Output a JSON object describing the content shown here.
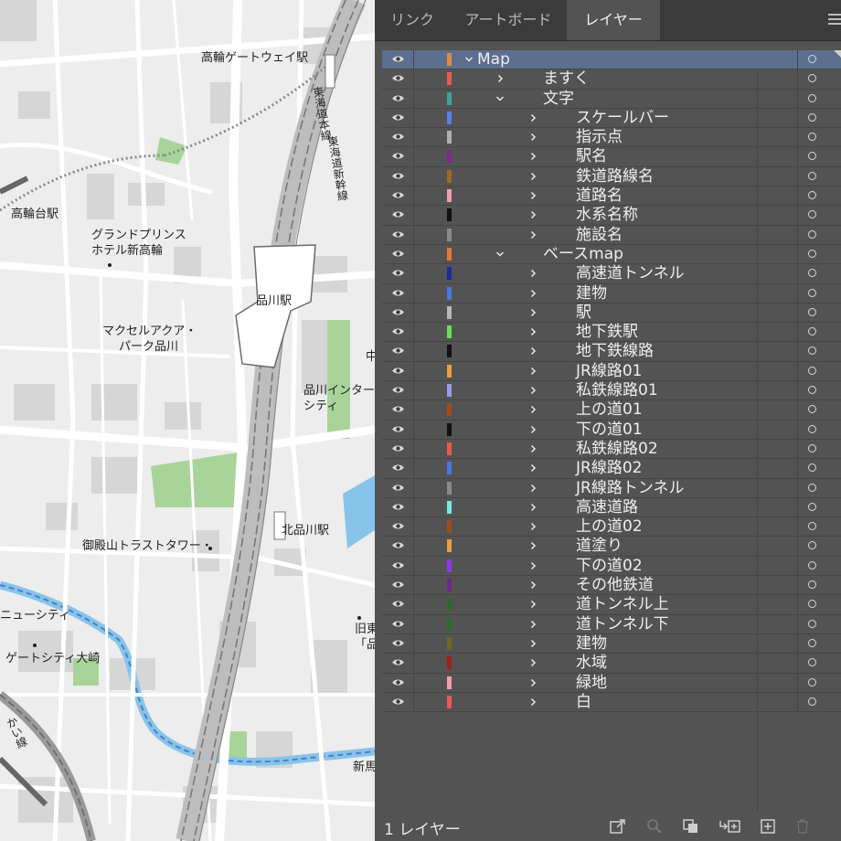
{
  "tabs": [
    {
      "label": "リンク",
      "active": false
    },
    {
      "label": "アートボード",
      "active": false
    },
    {
      "label": "レイヤー",
      "active": true
    }
  ],
  "map_labels": {
    "takanawa_gateway": "高輪ゲートウェイ駅",
    "takanawadai": "高輪台駅",
    "grand_prince_1": "グランドプリンス",
    "grand_prince_2": "ホテル新高輪",
    "shinagawa": "品川駅",
    "maxell_1": "マクセルアクア・",
    "maxell_2": "パーク品川",
    "intercity_1": "品川インター",
    "intercity_2": "シティ",
    "kitashinagawa": "北品川駅",
    "gotenyama": "御殿山トラストタワー・",
    "new_city": "ニューシティ",
    "gate_city": "ゲートシティ大崎",
    "kyu_1": "旧東",
    "kyu_2": "「品",
    "shinba": "新馬",
    "naka": "中",
    "tokaido": "東海道本線",
    "shinkansen": "東海道新幹線",
    "bottom_left_line": "かい線"
  },
  "layers": [
    {
      "name": "Map",
      "depth": 0,
      "expanded": true,
      "color": "#e08a4a",
      "selected": true
    },
    {
      "name": "ますく",
      "depth": 1,
      "expanded": false,
      "color": "#e85a5a"
    },
    {
      "name": "文字",
      "depth": 1,
      "expanded": true,
      "color": "#3aa69a"
    },
    {
      "name": "スケールバー",
      "depth": 2,
      "expanded": false,
      "color": "#5b7fe0"
    },
    {
      "name": "指示点",
      "depth": 2,
      "expanded": false,
      "color": "#b0b0b0"
    },
    {
      "name": "駅名",
      "depth": 2,
      "expanded": false,
      "color": "#7a2a8a"
    },
    {
      "name": "鉄道路線名",
      "depth": 2,
      "expanded": false,
      "color": "#9a6a2a"
    },
    {
      "name": "道路名",
      "depth": 2,
      "expanded": false,
      "color": "#f0a0a8"
    },
    {
      "name": "水系名称",
      "depth": 2,
      "expanded": false,
      "color": "#111111"
    },
    {
      "name": "施設名",
      "depth": 2,
      "expanded": false,
      "color": "#8a8a8a"
    },
    {
      "name": "ベースmap",
      "depth": 1,
      "expanded": true,
      "color": "#e07a3a"
    },
    {
      "name": "高速道トンネル",
      "depth": 2,
      "expanded": false,
      "color": "#1a2aa0"
    },
    {
      "name": "建物",
      "depth": 2,
      "expanded": false,
      "color": "#4a78e0"
    },
    {
      "name": "駅",
      "depth": 2,
      "expanded": false,
      "color": "#b8b8b8"
    },
    {
      "name": "地下鉄駅",
      "depth": 2,
      "expanded": false,
      "color": "#6ae05a"
    },
    {
      "name": "地下鉄線路",
      "depth": 2,
      "expanded": false,
      "color": "#111111"
    },
    {
      "name": "JR線路01",
      "depth": 2,
      "expanded": false,
      "color": "#e8a040"
    },
    {
      "name": "私鉄線路01",
      "depth": 2,
      "expanded": false,
      "color": "#9a9ae8"
    },
    {
      "name": "上の道01",
      "depth": 2,
      "expanded": false,
      "color": "#a04a20"
    },
    {
      "name": "下の道01",
      "depth": 2,
      "expanded": false,
      "color": "#111111"
    },
    {
      "name": "私鉄線路02",
      "depth": 2,
      "expanded": false,
      "color": "#e85a4a"
    },
    {
      "name": "JR線路02",
      "depth": 2,
      "expanded": false,
      "color": "#4a78e0"
    },
    {
      "name": "JR線路トンネル",
      "depth": 2,
      "expanded": false,
      "color": "#8a8a8a"
    },
    {
      "name": "高速道路",
      "depth": 2,
      "expanded": false,
      "color": "#7ae8e0"
    },
    {
      "name": "上の道02",
      "depth": 2,
      "expanded": false,
      "color": "#a04a20"
    },
    {
      "name": "道塗り",
      "depth": 2,
      "expanded": false,
      "color": "#e8a040"
    },
    {
      "name": "下の道02",
      "depth": 2,
      "expanded": false,
      "color": "#8a3ae0"
    },
    {
      "name": "その他鉄道",
      "depth": 2,
      "expanded": false,
      "color": "#6a2a8a"
    },
    {
      "name": "道トンネル上",
      "depth": 2,
      "expanded": false,
      "color": "#2a6a2a"
    },
    {
      "name": "道トンネル下",
      "depth": 2,
      "expanded": false,
      "color": "#2a6a2a"
    },
    {
      "name": "建物",
      "depth": 2,
      "expanded": false,
      "color": "#6a6a20"
    },
    {
      "name": "水域",
      "depth": 2,
      "expanded": false,
      "color": "#a02020"
    },
    {
      "name": "緑地",
      "depth": 2,
      "expanded": false,
      "color": "#f0a0a8"
    },
    {
      "name": "白",
      "depth": 2,
      "expanded": false,
      "color": "#e85a5a"
    }
  ],
  "footer": {
    "layer_count": "1 レイヤー"
  },
  "icons": [
    "eye-icon",
    "chevron-right-icon",
    "chevron-down-icon",
    "target-circle-icon",
    "menu-icon",
    "export-icon",
    "search-icon",
    "clip-mask-icon",
    "new-sublayer-icon",
    "new-layer-icon",
    "trash-icon"
  ],
  "colors": {
    "panel_bg": "#535353",
    "tab_bar_bg": "#3b3b3b",
    "selection": "#5c6f8f",
    "map_bg": "#ededed",
    "green_area": "#a8d49a",
    "water": "#88c4ea"
  }
}
